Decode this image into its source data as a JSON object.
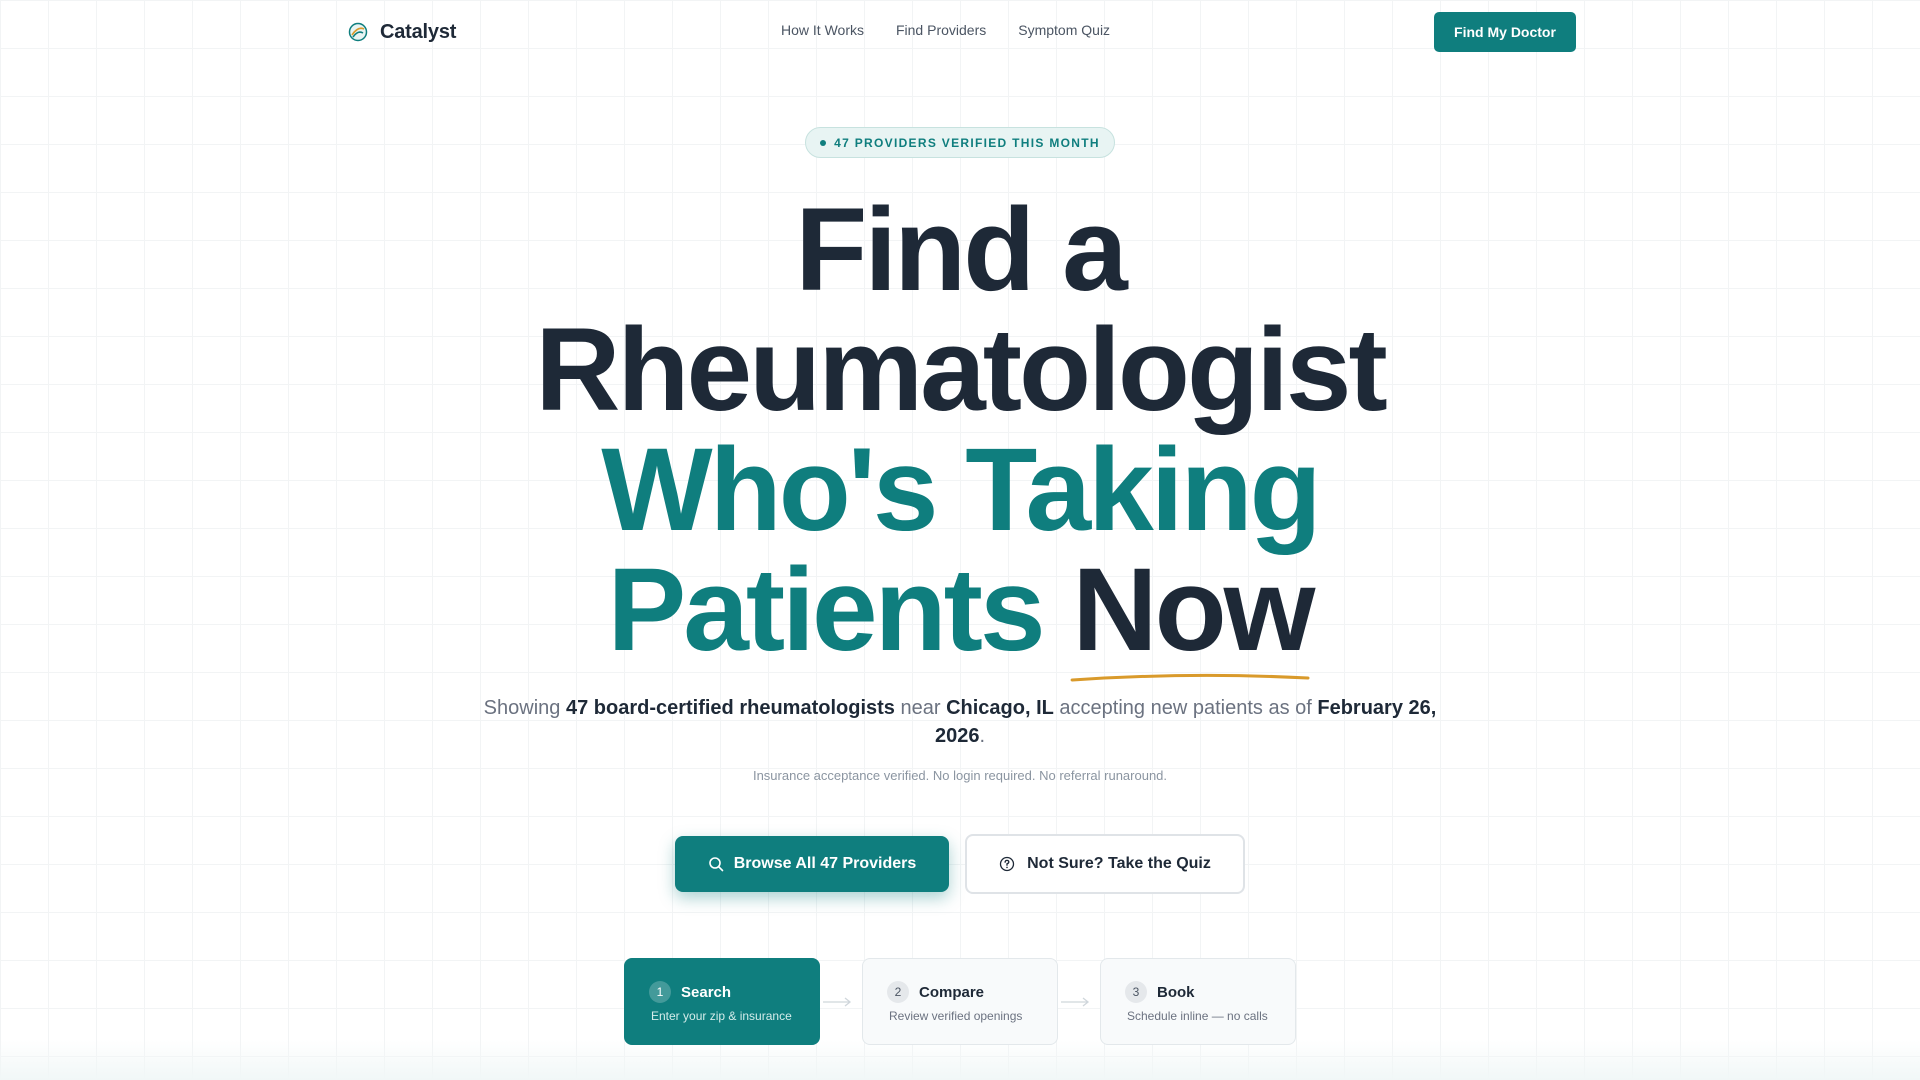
{
  "brand": {
    "name": "Catalyst",
    "logo_icon": "leaf-globe-icon"
  },
  "nav": {
    "links": [
      "How It Works",
      "Find Providers",
      "Symptom Quiz"
    ],
    "cta_label": "Find My Doctor"
  },
  "badge": {
    "text": "47 PROVIDERS VERIFIED THIS MONTH"
  },
  "headline": {
    "line1": "Find a",
    "line2": "Rheumatologist",
    "line3": "Who's Taking",
    "line4_teal": "Patients",
    "line4_dark": "Now"
  },
  "subtext": {
    "p1": "Showing ",
    "b1": "47 board-certified rheumatologists",
    "p2": " near ",
    "b2": "Chicago, IL",
    "p3": " accepting new patients as of ",
    "b3": "February 26, 2026",
    "p4": "."
  },
  "finetext": "Insurance acceptance verified. No login required. No referral runaround.",
  "buttons": {
    "primary": {
      "label": "Browse All 47 Providers",
      "icon": "search-icon"
    },
    "secondary": {
      "label": "Not Sure? Take the Quiz",
      "icon": "question-circle-icon"
    }
  },
  "steps": [
    {
      "num": "1",
      "title": "Search",
      "desc": "Enter your zip & insurance"
    },
    {
      "num": "2",
      "title": "Compare",
      "desc": "Review verified openings"
    },
    {
      "num": "3",
      "title": "Book",
      "desc": "Schedule inline — no calls"
    }
  ],
  "colors": {
    "accent": "#0f7e7e",
    "text": "#1e2937",
    "underline": "#d99a2b"
  }
}
